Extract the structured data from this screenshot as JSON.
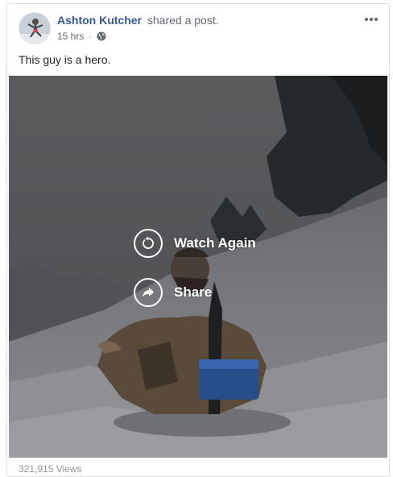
{
  "post": {
    "author": "Ashton Kutcher",
    "action": "shared a post.",
    "time": "15 hrs",
    "separator": "·",
    "privacy_icon": "globe-icon",
    "more_icon": "more-options-icon",
    "text": "This guy is a hero."
  },
  "video": {
    "watch_again_label": "Watch Again",
    "watch_again_icon": "replay-icon",
    "share_label": "Share",
    "share_icon": "share-arrow-icon"
  },
  "footer": {
    "views": "321,915 Views"
  },
  "colors": {
    "name_link": "#365899",
    "meta_text": "#616770",
    "border": "#dddfe2",
    "views_text": "#90949c"
  }
}
